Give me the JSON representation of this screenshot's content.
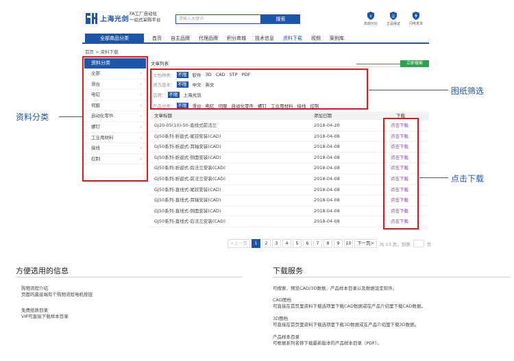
{
  "header": {
    "logo_text": "上海光剑",
    "slogan_line1": "FA工厂自动化",
    "slogan_line2": "一站式采购平台",
    "search_placeholder": "请输入关键词",
    "search_button": "搜索",
    "badges": [
      "高效价比",
      "正品保证",
      "闪电发货"
    ]
  },
  "nav": {
    "all_categories": "全部商品分类",
    "items": [
      "首页",
      "自主品牌",
      "代理品牌",
      "积分商城",
      "技术信息",
      "资料下载",
      "视频",
      "案例库"
    ],
    "active_index": 5
  },
  "breadcrumb": "首页 > 资料下载",
  "sidebar": {
    "title": "资料分类",
    "items": [
      "全部",
      "滑台",
      "电缸",
      "伺服",
      "自动化零件",
      "螺钉",
      "工业用材料",
      "接线",
      "控制"
    ]
  },
  "panel": {
    "title": "文章列表",
    "upload_button": "立即搜索"
  },
  "filters": [
    {
      "label": "文档种类：",
      "selected": "不限",
      "options": [
        "软件",
        "3D",
        "CAD",
        "STP",
        "PDF"
      ]
    },
    {
      "label": "语言版本：",
      "selected": "不限",
      "options": [
        "中文",
        "英文"
      ]
    },
    {
      "label": "品牌：",
      "selected": "不限",
      "options": [
        "上海光剑"
      ]
    },
    {
      "label": "产品分类：",
      "selected": "不限",
      "options": [
        "滑台",
        "电缸",
        "伺服",
        "自动化零件",
        "螺钉",
        "工业用材料",
        "接线",
        "控制"
      ]
    }
  ],
  "table": {
    "headers": [
      "文章标题",
      "添加日期",
      "下载"
    ],
    "rows": [
      {
        "title": "GJ20-05(10)-50-直线式前法兰",
        "date": "2018-04-20",
        "action": "点击下载"
      },
      {
        "title": "GJ50系列-折返式-尾铰安装(CAD)",
        "date": "2018-04-08",
        "action": "点击下载"
      },
      {
        "title": "GJ50系列-折返式-耳轴安装(CAD)",
        "date": "2018-04-08",
        "action": "点击下载"
      },
      {
        "title": "GJ50系列-折返式-侧面安装(CAD)",
        "date": "2018-04-08",
        "action": "点击下载"
      },
      {
        "title": "GJ50系列-折返式-后法兰安装(CAD)",
        "date": "2018-04-08",
        "action": "点击下载"
      },
      {
        "title": "GJ50系列-折返式-前法兰安装(CAD)",
        "date": "2018-04-08",
        "action": "点击下载"
      },
      {
        "title": "GJ50系列-直线式-尾铰安装(CAD)",
        "date": "2018-04-08",
        "action": "点击下载"
      },
      {
        "title": "GJ50系列-直线式-耳轴安装(CAD)",
        "date": "2018-04-08",
        "action": "点击下载"
      },
      {
        "title": "GJ50系列-直线式-侧面安装(CAD)",
        "date": "2018-04-08",
        "action": "点击下载"
      },
      {
        "title": "GJ50系列-直线式-后法兰安装(CAD)",
        "date": "2018-04-08",
        "action": "点击下载"
      }
    ]
  },
  "callouts": {
    "category": "资料分类",
    "filter": "图纸筛选",
    "download": "点击下载"
  },
  "pagination": {
    "prev": "<上一页",
    "pages": [
      "1",
      "2",
      "3",
      "4",
      "5",
      "6",
      "7",
      "8",
      "9",
      "10"
    ],
    "current": "1",
    "next": "下一页>",
    "total": "共 13 页，到第",
    "page_unit": "页"
  },
  "info_left": {
    "title": "方便选用的信息",
    "blocks": [
      {
        "line1": "购物流程介绍",
        "line2": "页面的最底端有个购物流程电机按钮"
      },
      {
        "line1": "免费纸质目录",
        "line2": "VIP可直接下载样本目录"
      }
    ]
  },
  "info_right": {
    "title": "下载服务",
    "blocks": [
      {
        "line1": "可搜索、预览CAD/3D数据、产品样本目录以及数据设定软件。",
        "line2": ""
      },
      {
        "line1": "CAD图档",
        "line2": "可直接在首页里资料下载选项里下载CAD数据或在产品介绍里下载CAD数据。"
      },
      {
        "line1": "3D图档",
        "line2": "可直接在首页里资料下载选项里下载3D数据或在产品介绍里下载3D数据。"
      },
      {
        "line1": "产品样本目录",
        "line2": "可根据系列名称下载最新版本的产品样本目录（PDF）。"
      }
    ]
  },
  "colors": {
    "brand": "#1d56a8",
    "highlight": "#e8161b",
    "download_link": "#8a3fbf",
    "green": "#2ba24c"
  }
}
